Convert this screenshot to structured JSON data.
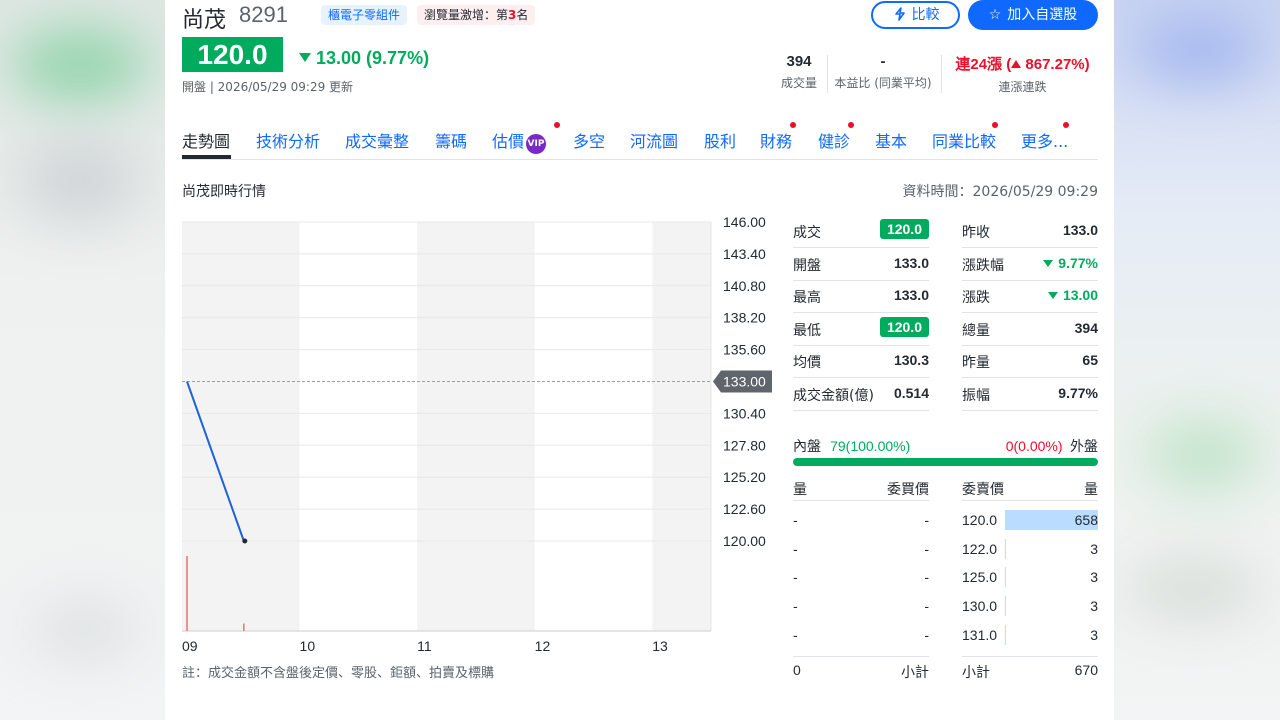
{
  "header": {
    "name": "尚茂",
    "code": "8291",
    "category_badge": "櫃電子零組件",
    "rank_badge_prefix": "瀏覽量激增：第",
    "rank_badge_num": "3",
    "rank_badge_suffix": "名",
    "compare_label": "比較",
    "watchlist_label": "加入自選股"
  },
  "price": {
    "current": "120.0",
    "change": "13.00 (9.77%)",
    "status": "開盤 | 2026/05/29 09:29 更新"
  },
  "stats": [
    {
      "value": "394",
      "label": "成交量"
    },
    {
      "value": "-",
      "label": "本益比 (同業平均)"
    },
    {
      "value_prefix": "連24漲 (",
      "value_num": "867.27%)",
      "label": "連漲連跌"
    }
  ],
  "tabs": [
    "走勢圖",
    "技術分析",
    "成交彙整",
    "籌碼",
    "估價",
    "多空",
    "河流圖",
    "股利",
    "財務",
    "健診",
    "基本",
    "同業比較",
    "更多..."
  ],
  "vip_label": "VIP",
  "section_title": "尚茂即時行情",
  "data_time": "資料時間：2026/05/29 09:29",
  "chart_data": {
    "type": "line",
    "x_ticks": [
      "09",
      "10",
      "11",
      "12",
      "13"
    ],
    "y_ticks": [
      "146.00",
      "143.40",
      "140.80",
      "138.20",
      "135.60",
      "133.00",
      "130.40",
      "127.80",
      "125.20",
      "122.60",
      "120.00"
    ],
    "ylim": [
      120.0,
      146.0
    ],
    "reference_price": 133.0,
    "reference_label": "133.00",
    "series": [
      {
        "x": [
          "09:00",
          "09:29"
        ],
        "values": [
          133.0,
          120.0
        ],
        "color": "#1d63d6"
      }
    ],
    "volume_bars": [
      {
        "x": "09:00",
        "height_fraction": 1.0,
        "color": "#e57373"
      },
      {
        "x": "09:29",
        "height_fraction": 0.1,
        "color": "#e57373"
      }
    ]
  },
  "quote": {
    "left": [
      {
        "label": "成交",
        "value": "120.0",
        "style": "boxed"
      },
      {
        "label": "開盤",
        "value": "133.0",
        "style": ""
      },
      {
        "label": "最高",
        "value": "133.0",
        "style": ""
      },
      {
        "label": "最低",
        "value": "120.0",
        "style": "boxed"
      },
      {
        "label": "均價",
        "value": "130.3",
        "style": ""
      },
      {
        "label": "成交金額(億)",
        "value": "0.514",
        "style": ""
      }
    ],
    "right": [
      {
        "label": "昨收",
        "value": "133.0",
        "style": ""
      },
      {
        "label": "漲跌幅",
        "value": "9.77%",
        "style": "green-down"
      },
      {
        "label": "漲跌",
        "value": "13.00",
        "style": "green-down"
      },
      {
        "label": "總量",
        "value": "394",
        "style": ""
      },
      {
        "label": "昨量",
        "value": "65",
        "style": ""
      },
      {
        "label": "振幅",
        "value": "9.77%",
        "style": ""
      }
    ]
  },
  "inner_outer": {
    "inner_label": "內盤",
    "inner_value": "79(100.00%)",
    "outer_value_num": "0",
    "outer_value_pct": "(0.00%)",
    "outer_label": "外盤",
    "inner_fraction": 1.0
  },
  "order_book": {
    "headers": [
      "量",
      "委買價",
      "委賣價",
      "量"
    ],
    "rows": [
      {
        "bid_vol": "-",
        "bid": "-",
        "ask": "120.0",
        "ask_vol": "658"
      },
      {
        "bid_vol": "-",
        "bid": "-",
        "ask": "122.0",
        "ask_vol": "3"
      },
      {
        "bid_vol": "-",
        "bid": "-",
        "ask": "125.0",
        "ask_vol": "3"
      },
      {
        "bid_vol": "-",
        "bid": "-",
        "ask": "130.0",
        "ask_vol": "3"
      },
      {
        "bid_vol": "-",
        "bid": "-",
        "ask": "131.0",
        "ask_vol": "3"
      }
    ],
    "bid_total": "0",
    "bid_total_label": "小計",
    "ask_total_label": "小計",
    "ask_total": "670"
  },
  "note": "註：成交金額不含盤後定價、零股、鉅額、拍賣及標購"
}
